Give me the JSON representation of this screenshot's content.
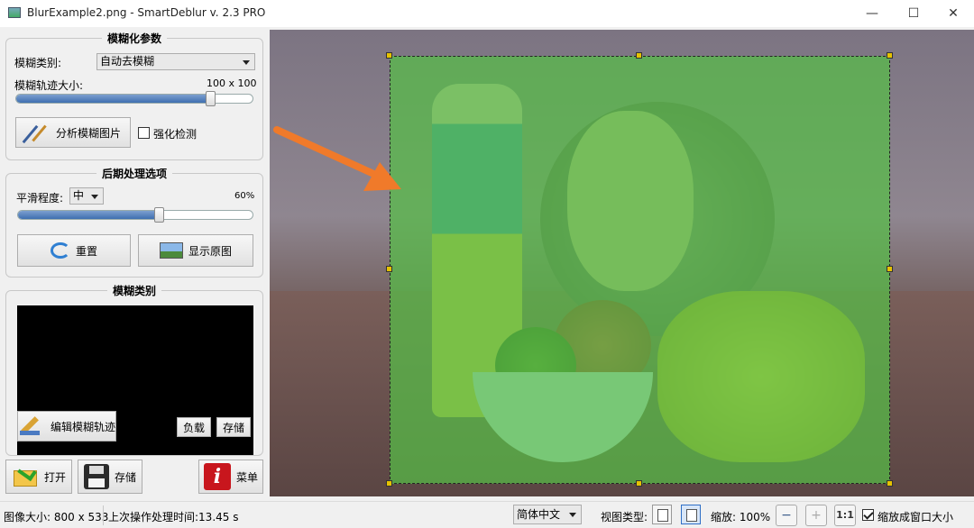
{
  "window": {
    "title": "BlurExample2.png - SmartDeblur v. 2.3 PRO",
    "minimize": "—",
    "maximize": "☐",
    "close": "✕"
  },
  "blur_params": {
    "group_title": "模糊化参数",
    "type_label": "模糊类别:",
    "type_value": "自动去模糊",
    "size_label": "模糊轨迹大小:",
    "size_value": "100  x  100",
    "size_fraction": 0.82,
    "analyze_button": "分析模糊图片",
    "enhance_label": "强化检测",
    "enhance_checked": false
  },
  "postprocess": {
    "group_title": "后期处理选项",
    "smooth_label": "平滑程度:",
    "smooth_value": "中",
    "smooth_percent": "60%",
    "smooth_fraction": 0.6,
    "reset_button": "重置",
    "show_original_button": "显示原图"
  },
  "kernel": {
    "group_title": "模糊类别",
    "edit_button": "编辑模糊轨迹",
    "load_button": "负载",
    "save_button": "存储"
  },
  "bottom_buttons": {
    "open": "打开",
    "save": "存储",
    "menu": "菜单"
  },
  "statusbar": {
    "image_size": "图像大小: 800 x 533",
    "last_time": "上次操作处理时间:13.45 s",
    "language": "简体中文",
    "view_type_label": "视图类型:",
    "zoom_label": "缩放: 100%",
    "zoom_1to1": "1:1",
    "fit_label": "缩放成窗口大小",
    "fit_checked": true
  },
  "colors": {
    "accent_arrow": "#f07a2a",
    "selection_overlay": "#56be46",
    "handle": "#e6c200"
  }
}
